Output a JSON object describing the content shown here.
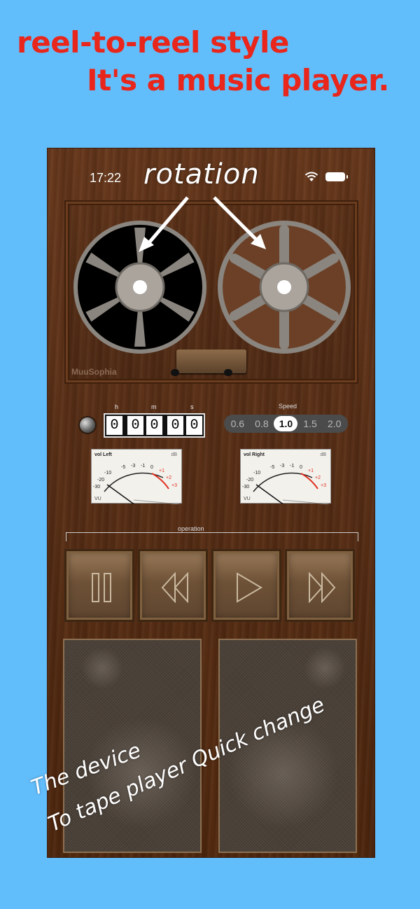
{
  "promo": {
    "line1": "reel-to-reel style",
    "line2": "It's a music player."
  },
  "annotation": {
    "rotation": "rotation"
  },
  "status": {
    "time": "17:22"
  },
  "deck": {
    "brand": "MuuSophia"
  },
  "counter": {
    "h_label": "h",
    "m_label": "m",
    "s_label": "s",
    "digits": [
      "0",
      "0",
      "0",
      "0",
      "0"
    ]
  },
  "speed": {
    "title": "Speed",
    "options": [
      "0.6",
      "0.8",
      "1.0",
      "1.5",
      "2.0"
    ],
    "selected": "1.0"
  },
  "vu_left": {
    "name": "vol Left",
    "unit": "dB",
    "scale_label": "VU",
    "ticks": [
      "-20",
      "-10",
      "-5",
      "-3",
      "-1",
      "0",
      "+1",
      "+2",
      "+3"
    ],
    "bottom_tick": "-30"
  },
  "vu_right": {
    "name": "vol Right",
    "unit": "dB",
    "scale_label": "VU",
    "ticks": [
      "-20",
      "-10",
      "-5",
      "-3",
      "-1",
      "0",
      "+1",
      "+2",
      "+3"
    ],
    "bottom_tick": "-30"
  },
  "operation": {
    "label": "operation",
    "buttons": [
      "pause-icon",
      "rewind-icon",
      "play-icon",
      "fast-forward-icon"
    ]
  },
  "caption": {
    "line1": "The device",
    "line2": "To tape player Quick change"
  }
}
